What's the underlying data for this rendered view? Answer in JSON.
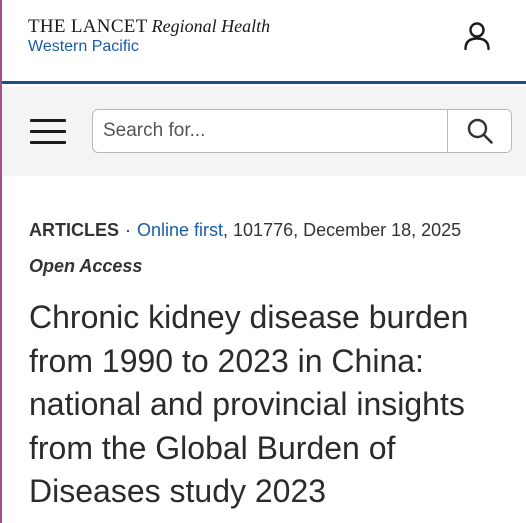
{
  "header": {
    "journal_name": "THE LANCET",
    "journal_subtitle": "Regional Health",
    "journal_region": "Western Pacific",
    "user_icon": "user-icon"
  },
  "search": {
    "menu_icon": "hamburger-menu-icon",
    "placeholder": "Search for...",
    "value": "",
    "submit_icon": "search-icon"
  },
  "article": {
    "type": "ARTICLES",
    "separator": "·",
    "status": "Online first",
    "details": ", 101776, December 18, 2025",
    "access": "Open Access",
    "title": "Chronic kidney disease burden from 1990 to 2023 in China: national and provincial insights from the Global Burden of Diseases study 2023"
  },
  "colors": {
    "brand_blue": "#1b5ca8",
    "header_rule": "#1b4f8a",
    "left_accent": "#a0508a",
    "toolbar_bg": "#f4f4f4"
  }
}
